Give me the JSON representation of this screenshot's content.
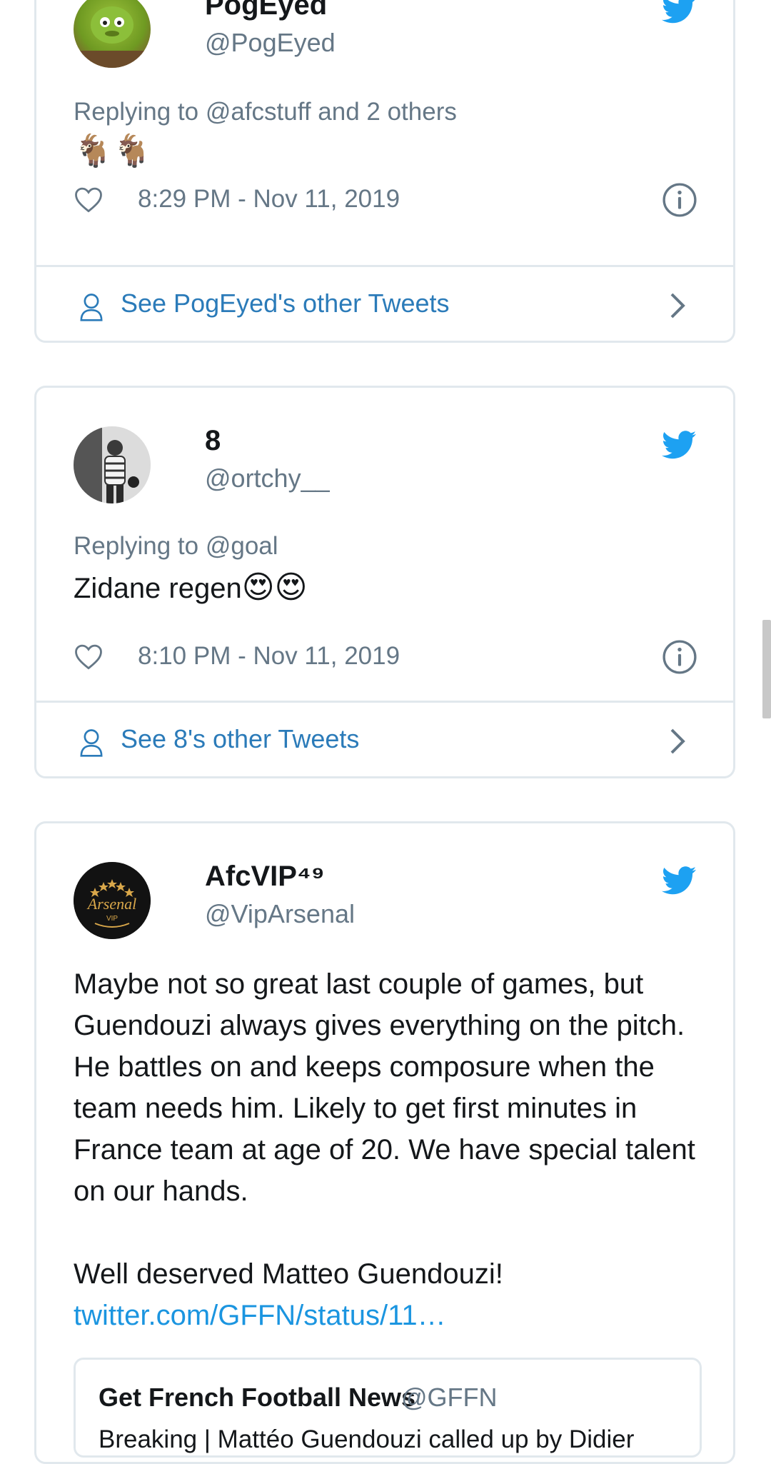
{
  "colors": {
    "border": "#e1e8ed",
    "secondary_text": "#657786",
    "link": "#2b7bb9",
    "twitter_blue": "#1da1f2"
  },
  "tweets": [
    {
      "name": "PogEyed",
      "handle": "@PogEyed",
      "replying_to": "Replying to @afcstuff and 2 others",
      "text": "🐐🐐",
      "timestamp": "8:29 PM - Nov 11, 2019",
      "see_other": "See PogEyed's other Tweets"
    },
    {
      "name": "8",
      "handle": "@ortchy__",
      "replying_to": "Replying to @goal",
      "text": "Zidane regen",
      "emojis": "😍😍",
      "timestamp": "8:10 PM - Nov 11, 2019",
      "see_other": "See 8's other Tweets"
    },
    {
      "name": "AfcVIP⁴⁹",
      "handle": "@VipArsenal",
      "avatar_text": "Arsenal",
      "avatar_subtext": "VIP",
      "body_paragraph_1": "Maybe not so great last couple of games, but Guendouzi always gives everything on the pitch. He battles on and keeps composure when the team needs him. Likely to get first minutes in France team at age of 20. We have special talent on our hands.",
      "body_paragraph_2": "Well deserved Matteo Guendouzi!",
      "link": "twitter.com/GFFN/status/11…",
      "quote": {
        "name": "Get French Football News",
        "handle": "@GFFN",
        "text": "Breaking | Mattéo Guendouzi called up by Didier"
      }
    }
  ]
}
